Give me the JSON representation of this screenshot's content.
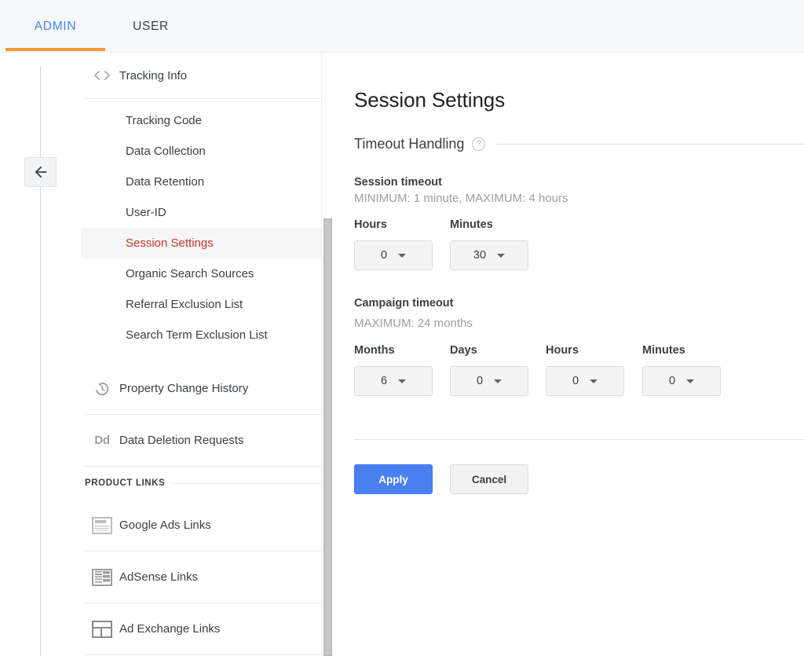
{
  "tabs": [
    {
      "label": "ADMIN",
      "active": true
    },
    {
      "label": "USER",
      "active": false
    }
  ],
  "accent_colors": {
    "tab_active_text": "#4285f4",
    "tab_underline": "#f09a36",
    "active_nav_text": "#c0392b",
    "apply_button": "#4a7ff0"
  },
  "rail": {
    "back_icon": "arrow-left-icon"
  },
  "sidebar": {
    "group": {
      "icon": "code-brackets-icon",
      "label": "Tracking Info"
    },
    "items": [
      {
        "label": "Tracking Code",
        "active": false
      },
      {
        "label": "Data Collection",
        "active": false
      },
      {
        "label": "Data Retention",
        "active": false
      },
      {
        "label": "User-ID",
        "active": false
      },
      {
        "label": "Session Settings",
        "active": true
      },
      {
        "label": "Organic Search Sources",
        "active": false
      },
      {
        "label": "Referral Exclusion List",
        "active": false
      },
      {
        "label": "Search Term Exclusion List",
        "active": false
      }
    ],
    "rows": [
      {
        "label": "Property Change History",
        "icon": "history-clock-icon"
      },
      {
        "label": "Data Deletion Requests",
        "icon": "dd-icon"
      }
    ],
    "product_links": {
      "title": "PRODUCT LINKS",
      "items": [
        {
          "label": "Google Ads Links",
          "icon": "google-ads-icon"
        },
        {
          "label": "AdSense Links",
          "icon": "adsense-icon"
        },
        {
          "label": "Ad Exchange Links",
          "icon": "ad-exchange-icon"
        }
      ]
    }
  },
  "main": {
    "title": "Session Settings",
    "section": {
      "name": "Timeout Handling",
      "help_icon": "help-circle-icon"
    },
    "session_timeout": {
      "title": "Session timeout",
      "hint": "MINIMUM: 1 minute, MAXIMUM: 4 hours",
      "fields": [
        {
          "label": "Hours",
          "value": "0"
        },
        {
          "label": "Minutes",
          "value": "30"
        }
      ]
    },
    "campaign_timeout": {
      "title": "Campaign timeout",
      "hint": "MAXIMUM: 24 months",
      "fields": [
        {
          "label": "Months",
          "value": "6"
        },
        {
          "label": "Days",
          "value": "0"
        },
        {
          "label": "Hours",
          "value": "0"
        },
        {
          "label": "Minutes",
          "value": "0"
        }
      ]
    },
    "actions": {
      "apply": "Apply",
      "cancel": "Cancel"
    }
  }
}
